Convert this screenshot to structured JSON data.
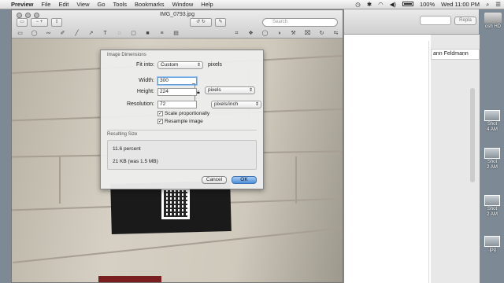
{
  "menubar": {
    "apple": "",
    "app_name": "Preview",
    "items": [
      "File",
      "Edit",
      "View",
      "Go",
      "Tools",
      "Bookmarks",
      "Window",
      "Help"
    ],
    "battery": "100%",
    "clock": "Wed 11:00 PM",
    "search_icon": "search-icon"
  },
  "window": {
    "title": "IMG_0793.jpg",
    "search_placeholder": "Search"
  },
  "dialog": {
    "section_dimensions": "Image Dimensions",
    "fit_into_label": "Fit into:",
    "fit_into_value": "Custom",
    "fit_into_unit": "pixels",
    "width_label": "Width:",
    "width_value": "300",
    "height_label": "Height:",
    "height_value": "224",
    "size_unit": "pixels",
    "resolution_label": "Resolution:",
    "resolution_value": "72",
    "resolution_unit": "pixels/inch",
    "scale_label": "Scale proportionally",
    "scale_checked": true,
    "resample_label": "Resample image",
    "resample_checked": true,
    "section_result": "Resulting Size",
    "percent": "11.6 percent",
    "filesize": "21 KB (was 1.5 MB)",
    "cancel": "Cancel",
    "ok": "OK"
  },
  "background_window": {
    "field_text": "ann Feldmann",
    "button": "Repla"
  },
  "desktop": {
    "drive_label": "osh HD",
    "icons": [
      {
        "line1": "Shot",
        "line2": "4 AM"
      },
      {
        "line1": "Shot",
        "line2": "2 AM"
      },
      {
        "line1": "Shot",
        "line2": "2 AM"
      },
      {
        "line1": "",
        "line2": ".jpg"
      }
    ]
  }
}
